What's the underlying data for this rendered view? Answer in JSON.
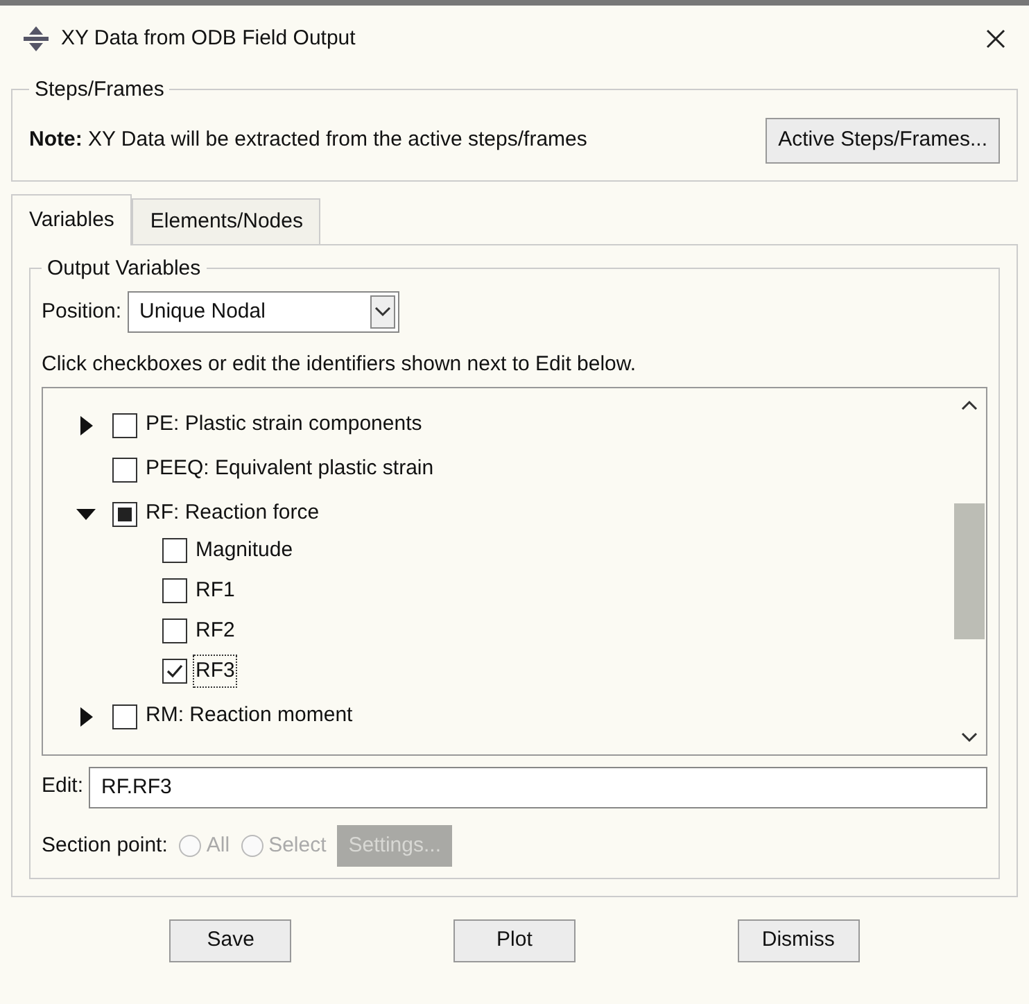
{
  "window": {
    "title": "XY Data from ODB Field Output"
  },
  "steps_frames": {
    "title": "Steps/Frames",
    "note_label": "Note:",
    "note": "XY Data will be extracted from the active steps/frames",
    "button": "Active Steps/Frames..."
  },
  "tabs": [
    {
      "label": "Variables",
      "selected": true
    },
    {
      "label": "Elements/Nodes",
      "selected": false
    }
  ],
  "output_variables": {
    "title": "Output Variables",
    "position_label": "Position:",
    "position_value": "Unique Nodal",
    "hint": "Click checkboxes or edit the identifiers shown next to Edit below.",
    "tree": [
      {
        "label": "PE: Plastic strain components",
        "checked": false,
        "partial": false,
        "expanded": false
      },
      {
        "label": "PEEQ: Equivalent plastic strain",
        "checked": false,
        "partial": false
      },
      {
        "label": "RF: Reaction force",
        "checked": false,
        "partial": true,
        "expanded": true,
        "children": [
          {
            "label": "Magnitude",
            "checked": false,
            "focused": false
          },
          {
            "label": "RF1",
            "checked": false,
            "focused": false
          },
          {
            "label": "RF2",
            "checked": false,
            "focused": false
          },
          {
            "label": "RF3",
            "checked": true,
            "focused": true
          }
        ]
      },
      {
        "label": "RM: Reaction moment",
        "checked": false,
        "partial": false,
        "expanded": false
      }
    ],
    "edit_label": "Edit:",
    "edit_value": "RF.RF3",
    "section_label": "Section point:",
    "section_options": [
      {
        "label": "All",
        "selected": false,
        "disabled": true
      },
      {
        "label": "Select",
        "selected": false,
        "disabled": true
      }
    ],
    "settings_button": {
      "label": "Settings...",
      "disabled": true
    }
  },
  "buttons": [
    "Save",
    "Plot",
    "Dismiss"
  ]
}
